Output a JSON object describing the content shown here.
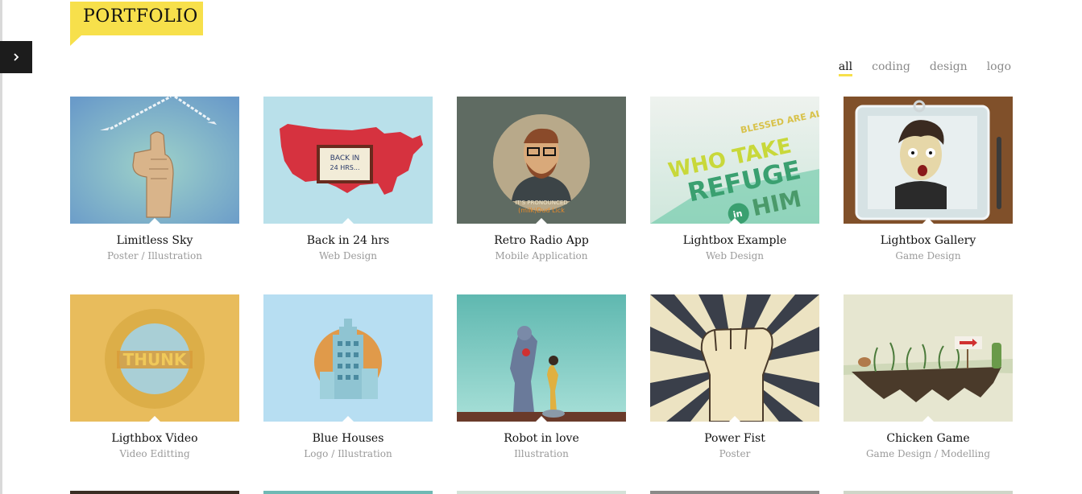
{
  "section": {
    "title": "PORTFOLIO"
  },
  "sidebar": {
    "toggle_icon": "chevron-right-icon"
  },
  "filters": [
    "all",
    "coding",
    "design",
    "logo"
  ],
  "active_filter": "all",
  "colors": {
    "accent": "#f7e04b",
    "dark": "#1c1c1c"
  },
  "items": [
    {
      "title": "Limitless Sky",
      "category": "Poster / Illustration"
    },
    {
      "title": "Back in 24 hrs",
      "category": "Web Design"
    },
    {
      "title": "Retro Radio App",
      "category": "Mobile Application"
    },
    {
      "title": "Lightbox Example",
      "category": "Web Design"
    },
    {
      "title": "Lightbox Gallery",
      "category": "Game Design"
    },
    {
      "title": "Ligthbox Video",
      "category": "Video Editting"
    },
    {
      "title": "Blue Houses",
      "category": "Logo / Illustration"
    },
    {
      "title": "Robot in love",
      "category": "Illustration"
    },
    {
      "title": "Power Fist",
      "category": "Poster"
    },
    {
      "title": "Chicken Game",
      "category": "Game Design / Modelling"
    }
  ],
  "thumb_text": {
    "back_in": "BACK IN",
    "hrs": "24 HRS...",
    "pronounced": "IT'S PRONOUNCED",
    "milk": "(milk)Dud  Lick",
    "blessed": "BLESSED ARE ALL",
    "who_take": "WHO TAKE",
    "refuge": "REFUGE",
    "in": "in",
    "him": "HIM",
    "thunk": "THUNK"
  }
}
